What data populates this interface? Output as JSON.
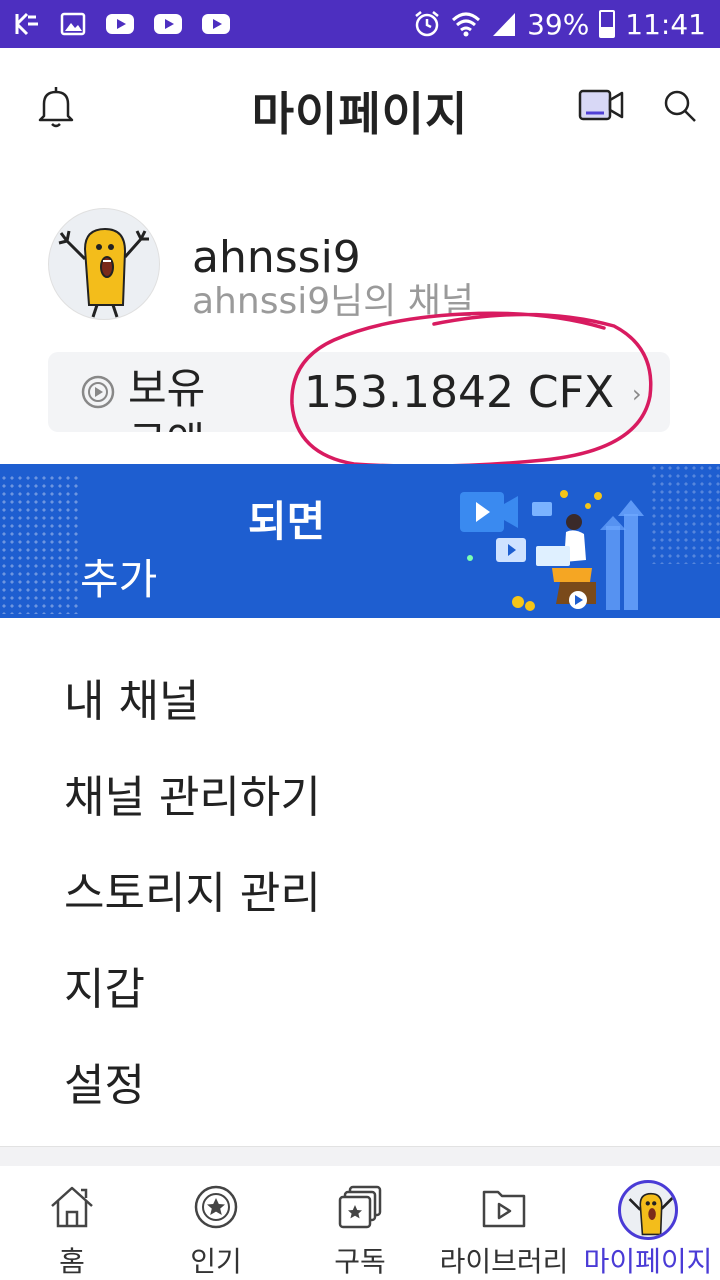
{
  "status_bar": {
    "battery_percent": "39%",
    "battery_level": 0.39,
    "time": "11:41",
    "icons": [
      "k-icon",
      "gallery-icon",
      "youtube-icon",
      "youtube-icon",
      "youtube-icon",
      "alarm-icon",
      "wifi-icon",
      "signal-icon",
      "battery-icon"
    ]
  },
  "header": {
    "title": "마이페이지",
    "icons": [
      "bell-icon",
      "video-camera-icon",
      "search-icon"
    ]
  },
  "profile": {
    "username": "ahnssi9",
    "channel_name": "ahnssi9님의 채널"
  },
  "balance": {
    "label": "보유 금액",
    "value": "153.1842 CFX",
    "chevron": "›"
  },
  "banner": {
    "line1": "되면",
    "line2": "추가"
  },
  "menu": {
    "items": [
      {
        "label": "내 채널"
      },
      {
        "label": "채널 관리하기"
      },
      {
        "label": "스토리지 관리"
      },
      {
        "label": "지갑"
      },
      {
        "label": "설정"
      }
    ]
  },
  "bottom_nav": {
    "items": [
      {
        "label": "홈",
        "icon": "home-icon"
      },
      {
        "label": "인기",
        "icon": "popular-star-icon"
      },
      {
        "label": "구독",
        "icon": "subscriptions-icon"
      },
      {
        "label": "라이브러리",
        "icon": "library-icon"
      },
      {
        "label": "마이페이지",
        "icon": "avatar-icon",
        "active": true
      }
    ]
  },
  "colors": {
    "status_bar": "#4d2fc0",
    "banner": "#1e5ed0",
    "accent": "#4a3bd6",
    "annotation": "#d81b60"
  }
}
